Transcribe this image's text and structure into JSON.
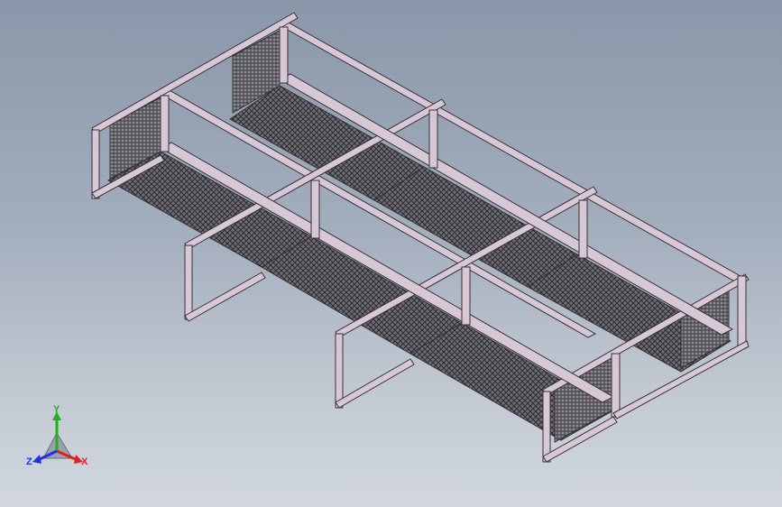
{
  "window": {
    "title": ""
  },
  "viewport": {
    "model": "walkway-frame-with-grating",
    "bg_top": "#8a97aa",
    "bg_bottom": "#d2d7de",
    "frame_color": "#d6c8d4",
    "frame_edge": "#3a3038",
    "grating_color": "#3c3c40"
  },
  "triad": {
    "x_label": "X",
    "y_label": "Y",
    "z_label": "Z",
    "x_color": "#e02020",
    "y_color": "#20b020",
    "z_color": "#2030e0"
  }
}
